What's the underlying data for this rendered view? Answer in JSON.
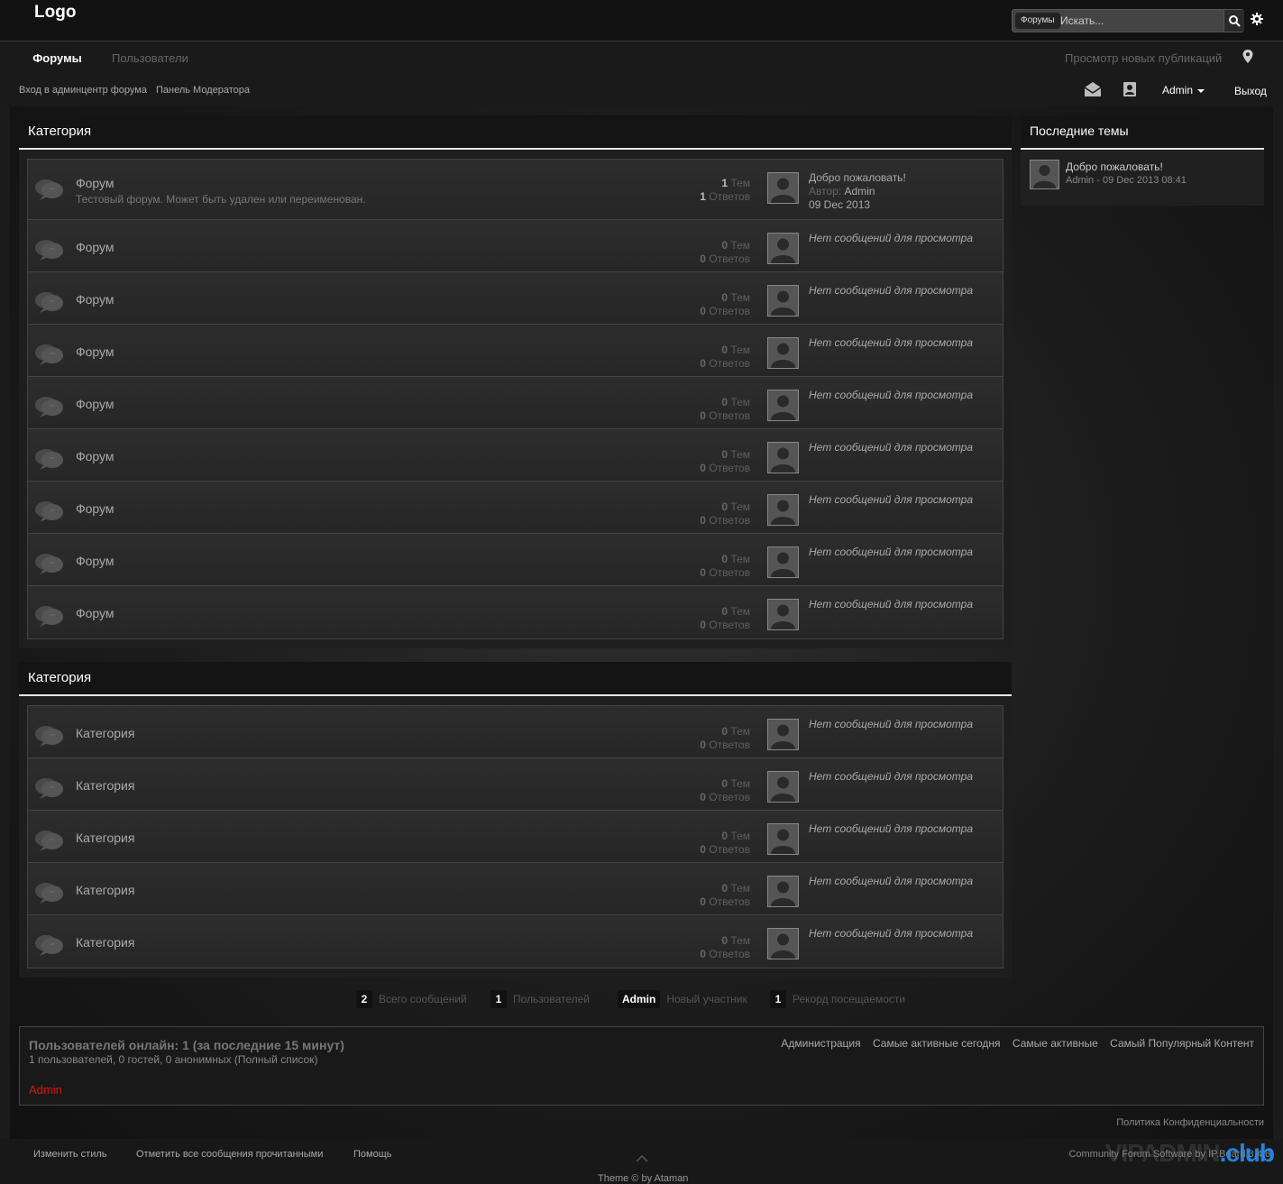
{
  "header": {
    "logo": "Logo",
    "search_scope": "Форумы",
    "search_placeholder": "Искать..."
  },
  "nav": {
    "tabs": [
      {
        "label": "Форумы"
      },
      {
        "label": "Пользователи"
      }
    ],
    "view_new": "Просмотр новых публикаций",
    "admin_cp": "Вход в админцентр форума",
    "mod_cp": "Панель Модератора",
    "user": "Admin",
    "logout": "Выход"
  },
  "categories": [
    {
      "title": "Категория",
      "forums": [
        {
          "name": "Форум",
          "desc": "Тестовый форум. Может быть удален или переименован.",
          "topics": "1",
          "topics_label": "Тем",
          "replies": "1",
          "replies_label": "Ответов",
          "last_title": "Добро пожаловать!",
          "last_author_label": "Автор:",
          "last_author": "Admin",
          "last_date": "09 Dec 2013"
        },
        {
          "name": "Форум",
          "topics": "0",
          "topics_label": "Тем",
          "replies": "0",
          "replies_label": "Ответов",
          "last_empty": "Нет сообщений для просмотра"
        },
        {
          "name": "Форум",
          "topics": "0",
          "topics_label": "Тем",
          "replies": "0",
          "replies_label": "Ответов",
          "last_empty": "Нет сообщений для просмотра"
        },
        {
          "name": "Форум",
          "topics": "0",
          "topics_label": "Тем",
          "replies": "0",
          "replies_label": "Ответов",
          "last_empty": "Нет сообщений для просмотра"
        },
        {
          "name": "Форум",
          "topics": "0",
          "topics_label": "Тем",
          "replies": "0",
          "replies_label": "Ответов",
          "last_empty": "Нет сообщений для просмотра"
        },
        {
          "name": "Форум",
          "topics": "0",
          "topics_label": "Тем",
          "replies": "0",
          "replies_label": "Ответов",
          "last_empty": "Нет сообщений для просмотра"
        },
        {
          "name": "Форум",
          "topics": "0",
          "topics_label": "Тем",
          "replies": "0",
          "replies_label": "Ответов",
          "last_empty": "Нет сообщений для просмотра"
        },
        {
          "name": "Форум",
          "topics": "0",
          "topics_label": "Тем",
          "replies": "0",
          "replies_label": "Ответов",
          "last_empty": "Нет сообщений для просмотра"
        },
        {
          "name": "Форум",
          "topics": "0",
          "topics_label": "Тем",
          "replies": "0",
          "replies_label": "Ответов",
          "last_empty": "Нет сообщений для просмотра"
        }
      ]
    },
    {
      "title": "Категория",
      "forums": [
        {
          "name": "Категория",
          "topics": "0",
          "topics_label": "Тем",
          "replies": "0",
          "replies_label": "Ответов",
          "last_empty": "Нет сообщений для просмотра"
        },
        {
          "name": "Категория",
          "topics": "0",
          "topics_label": "Тем",
          "replies": "0",
          "replies_label": "Ответов",
          "last_empty": "Нет сообщений для просмотра"
        },
        {
          "name": "Категория",
          "topics": "0",
          "topics_label": "Тем",
          "replies": "0",
          "replies_label": "Ответов",
          "last_empty": "Нет сообщений для просмотра"
        },
        {
          "name": "Категория",
          "topics": "0",
          "topics_label": "Тем",
          "replies": "0",
          "replies_label": "Ответов",
          "last_empty": "Нет сообщений для просмотра"
        },
        {
          "name": "Категория",
          "topics": "0",
          "topics_label": "Тем",
          "replies": "0",
          "replies_label": "Ответов",
          "last_empty": "Нет сообщений для просмотра"
        }
      ]
    }
  ],
  "sidebar": {
    "title": "Последние темы",
    "recent": {
      "title": "Добро пожаловать!",
      "meta": "Admin - 09 Dec 2013 08:41"
    }
  },
  "stats": [
    {
      "value": "2",
      "label": "Всего сообщений"
    },
    {
      "value": "1",
      "label": "Пользователей"
    },
    {
      "value": "Admin",
      "label": "Новый участник"
    },
    {
      "value": "1",
      "label": "Рекорд посещаемости"
    }
  ],
  "online": {
    "title": "Пользователей онлайн: 1 (за последние 15 минут)",
    "sub": "1 пользователей, 0 гостей, 0 анонимных   (Полный список)",
    "user": "Admin",
    "user_color": "#e11111",
    "links": [
      "Администрация",
      "Самые активные сегодня",
      "Самые активные",
      "Самый Популярный Контент"
    ]
  },
  "privacy": "Политика Конфиденциальности",
  "footer": {
    "links": [
      "Изменить стиль",
      "Отметить все сообщения прочитанными",
      "Помощь"
    ],
    "copyright": "Community Forum Software by IP.Board 3.4.6",
    "theme_credit": "Theme © by Ataman",
    "watermark_a": "VIPADMIN",
    "watermark_b": ".club"
  }
}
